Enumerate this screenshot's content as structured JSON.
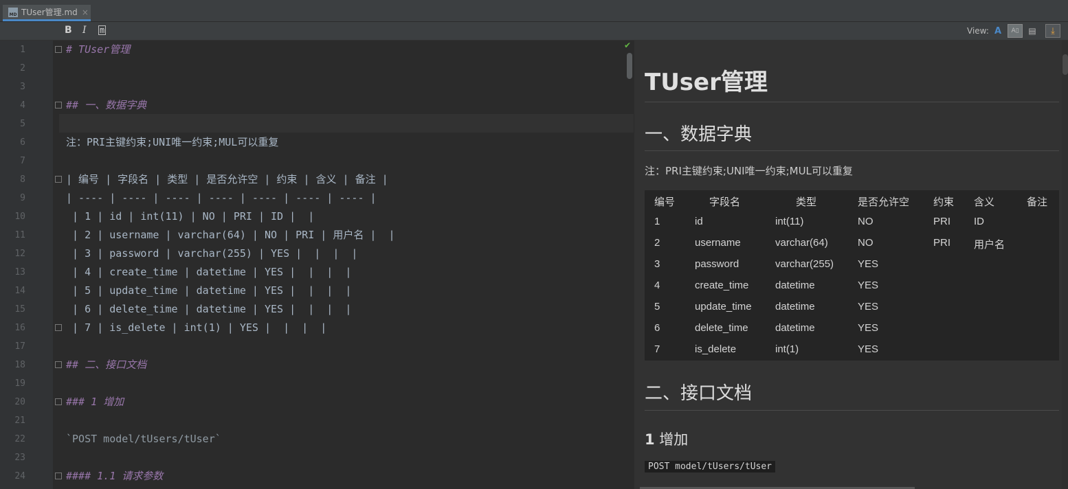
{
  "tab": {
    "icon_text": "MD",
    "title": "TUser管理.md",
    "close": "×"
  },
  "toolbar": {
    "bold": "B",
    "italic": "I",
    "code": "m",
    "view_label": "View:",
    "view_text": "A",
    "view_split": "A▯",
    "view_preview": "▤",
    "view_sync": "⤓"
  },
  "editor": {
    "check": "✔",
    "lines": [
      {
        "n": "1",
        "text": "# TUser管理",
        "style": "hd",
        "fold": "⊟"
      },
      {
        "n": "2",
        "text": "",
        "style": ""
      },
      {
        "n": "3",
        "text": "",
        "style": ""
      },
      {
        "n": "4",
        "text": "## 一、数据字典",
        "style": "hd",
        "fold": "⊟"
      },
      {
        "n": "5",
        "text": "",
        "style": ""
      },
      {
        "n": "6",
        "text": "注：PRI主键约束;UNI唯一约束;MUL可以重复",
        "style": ""
      },
      {
        "n": "7",
        "text": "",
        "style": ""
      },
      {
        "n": "8",
        "text": "| 编号 | 字段名 | 类型 | 是否允许空 | 约束 | 含义 | 备注 |",
        "style": "",
        "fold": "⊟"
      },
      {
        "n": "9",
        "text": "| ---- | ---- | ---- | ---- | ---- | ---- | ---- |",
        "style": ""
      },
      {
        "n": "10",
        "text": " | 1 | id | int(11) | NO | PRI | ID |  |",
        "style": ""
      },
      {
        "n": "11",
        "text": " | 2 | username | varchar(64) | NO | PRI | 用户名 |  |",
        "style": ""
      },
      {
        "n": "12",
        "text": " | 3 | password | varchar(255) | YES |  |  |  |",
        "style": ""
      },
      {
        "n": "13",
        "text": " | 4 | create_time | datetime | YES |  |  |  |",
        "style": ""
      },
      {
        "n": "14",
        "text": " | 5 | update_time | datetime | YES |  |  |  |",
        "style": ""
      },
      {
        "n": "15",
        "text": " | 6 | delete_time | datetime | YES |  |  |  |",
        "style": ""
      },
      {
        "n": "16",
        "text": " | 7 | is_delete | int(1) | YES |  |  |  |",
        "style": "",
        "fold": "⊟"
      },
      {
        "n": "17",
        "text": "",
        "style": ""
      },
      {
        "n": "18",
        "text": "## 二、接口文档",
        "style": "hd",
        "fold": "⊟"
      },
      {
        "n": "19",
        "text": "",
        "style": ""
      },
      {
        "n": "20",
        "text": "### 1 增加",
        "style": "hd",
        "fold": "⊟"
      },
      {
        "n": "21",
        "text": "",
        "style": ""
      },
      {
        "n": "22",
        "text": "`POST model/tUsers/tUser`",
        "style": "codeline"
      },
      {
        "n": "23",
        "text": "",
        "style": ""
      },
      {
        "n": "24",
        "text": "#### 1.1 请求参数",
        "style": "hd",
        "fold": "⊟"
      }
    ]
  },
  "preview": {
    "h1": "TUser管理",
    "h2a": "一、数据字典",
    "note": "注：PRI主键约束;UNI唯一约束;MUL可以重复",
    "table": {
      "headers": [
        "编号",
        "字段名",
        "类型",
        "是否允许空",
        "约束",
        "含义",
        "备注"
      ],
      "rows": [
        [
          "1",
          "id",
          "int(11)",
          "NO",
          "PRI",
          "ID",
          ""
        ],
        [
          "2",
          "username",
          "varchar(64)",
          "NO",
          "PRI",
          "用户名",
          ""
        ],
        [
          "3",
          "password",
          "varchar(255)",
          "YES",
          "",
          "",
          ""
        ],
        [
          "4",
          "create_time",
          "datetime",
          "YES",
          "",
          "",
          ""
        ],
        [
          "5",
          "update_time",
          "datetime",
          "YES",
          "",
          "",
          ""
        ],
        [
          "6",
          "delete_time",
          "datetime",
          "YES",
          "",
          "",
          ""
        ],
        [
          "7",
          "is_delete",
          "int(1)",
          "YES",
          "",
          "",
          ""
        ]
      ]
    },
    "h2b": "二、接口文档",
    "h3_num": "1",
    "h3_text": " 增加",
    "code": "POST model/tUsers/tUser"
  }
}
